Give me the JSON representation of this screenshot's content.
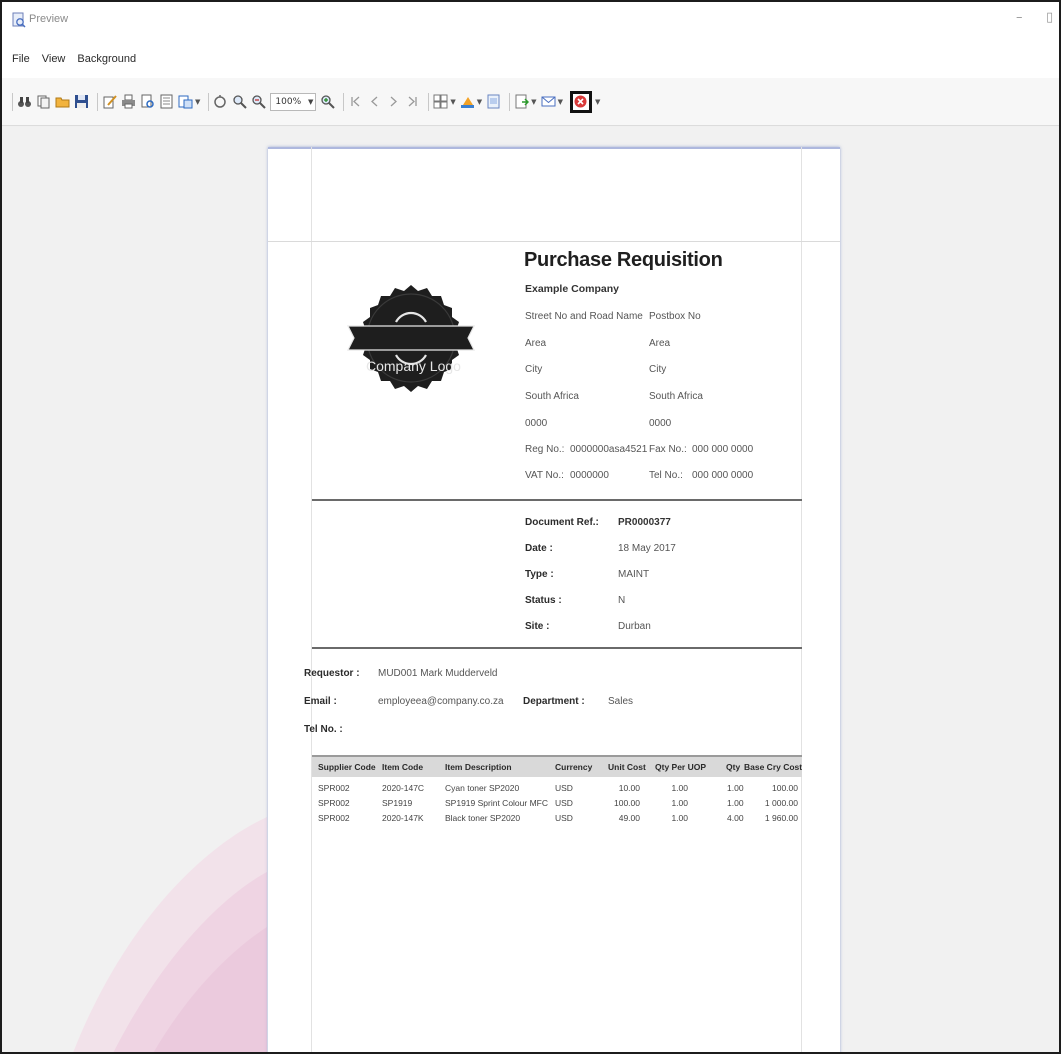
{
  "window": {
    "title": "Preview",
    "minimize_glyph": "–",
    "restore_glyph": "▯"
  },
  "menu": [
    "File",
    "View",
    "Background"
  ],
  "toolbar": {
    "zoom_value": "100%",
    "icons": [
      "binoculars-icon",
      "copy-icon",
      "open-icon",
      "save-icon",
      "edit-icon",
      "print-icon",
      "print-preview-icon",
      "page-setup-icon",
      "scale-icon",
      "hand-icon",
      "magnifier-icon",
      "zoom-out-icon",
      "zoom-in-icon",
      "first-page-icon",
      "previous-page-icon",
      "next-page-icon",
      "last-page-icon",
      "multi-page-icon",
      "color-icon",
      "watermark-icon",
      "export-icon",
      "email-icon",
      "close-preview-icon"
    ]
  },
  "document": {
    "title": "Purchase Requisition",
    "company": "Example Company",
    "logo_text": "Company Logo",
    "address_left": [
      "Street No and Road Name",
      "Area",
      "City",
      "South Africa",
      "0000"
    ],
    "address_right": [
      "Postbox No",
      "Area",
      "City",
      "South Africa",
      "0000"
    ],
    "reg_label": "Reg No.:",
    "reg_value": "0000000asa4521",
    "fax_label": "Fax No.:",
    "fax_value": "000 000 0000",
    "vat_label": "VAT No.:",
    "vat_value": "0000000",
    "tel_label": "Tel No.:",
    "tel_value": "000 000 0000",
    "info": [
      {
        "label": "Document Ref.:",
        "value": "PR0000377"
      },
      {
        "label": "Date :",
        "value": "18 May 2017"
      },
      {
        "label": "Type :",
        "value": "MAINT"
      },
      {
        "label": "Status :",
        "value": "N"
      },
      {
        "label": "Site :",
        "value": "Durban"
      }
    ],
    "requestor_label": "Requestor :",
    "requestor_value": "MUD001 Mark Mudderveld",
    "email_label": "Email :",
    "email_value": "employeea@company.co.za",
    "department_label": "Department :",
    "department_value": "Sales",
    "telno_label": "Tel No. :",
    "columns": [
      "Supplier Code",
      "Item Code",
      "Item Description",
      "Currency",
      "Unit Cost",
      "Qty Per UOP",
      "Qty",
      "Base Cry Cost"
    ],
    "rows": [
      [
        "SPR002",
        "2020-147C",
        "Cyan toner SP2020",
        "USD",
        "10.00",
        "1.00",
        "1.00",
        "100.00"
      ],
      [
        "SPR002",
        "SP1919",
        "SP1919 Sprint Colour MFC",
        "USD",
        "100.00",
        "1.00",
        "1.00",
        "1 000.00"
      ],
      [
        "SPR002",
        "2020-147K",
        "Black toner SP2020",
        "USD",
        "49.00",
        "1.00",
        "4.00",
        "1 960.00"
      ]
    ]
  }
}
